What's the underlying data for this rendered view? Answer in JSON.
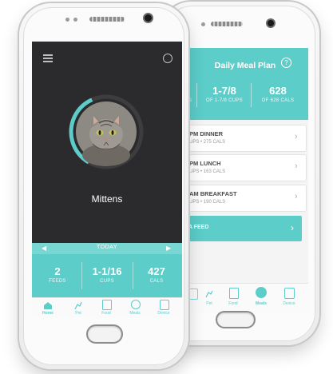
{
  "back_phone": {
    "header_title": "Daily Meal Plan",
    "help_icon": "question-circle-icon",
    "stats": [
      {
        "value": "",
        "label": "S"
      },
      {
        "value": "1-7/8",
        "label": "OF 1-7/8 CUPS"
      },
      {
        "value": "628",
        "label": "OF 628 CALS"
      }
    ],
    "meals": [
      {
        "title": "PM DINNER",
        "sub": "UPS • 275 CALS"
      },
      {
        "title": "PM LUNCH",
        "sub": "UPS • 163 CALS"
      },
      {
        "title": "AM BREAKFAST",
        "sub": "UPS • 190 CALS"
      }
    ],
    "add_feed_label": "A FEED",
    "nav": [
      {
        "label": "",
        "icon": "home-icon"
      },
      {
        "label": "Pet",
        "icon": "pet-icon"
      },
      {
        "label": "Food",
        "icon": "food-bag-icon"
      },
      {
        "label": "Meals",
        "icon": "meals-icon"
      },
      {
        "label": "Device",
        "icon": "device-icon"
      }
    ]
  },
  "front_phone": {
    "menu_icon": "hamburger-menu-icon",
    "settings_icon": "circle-settings-icon",
    "pet_name": "Mittens",
    "progress_fraction": 0.35,
    "date_label": "TODAY",
    "stats": [
      {
        "value": "2",
        "label": "FEEDS"
      },
      {
        "value": "1-1/16",
        "label": "CUPS"
      },
      {
        "value": "427",
        "label": "CALS"
      }
    ],
    "nav": [
      {
        "label": "Home",
        "icon": "home-icon",
        "active": true
      },
      {
        "label": "Pet",
        "icon": "pet-icon"
      },
      {
        "label": "Food",
        "icon": "food-bag-icon"
      },
      {
        "label": "Meals",
        "icon": "meals-icon"
      },
      {
        "label": "Device",
        "icon": "device-icon"
      }
    ]
  },
  "colors": {
    "accent": "#5ccdc9",
    "dark_bg": "#2b2b2d",
    "avatar_ring": "#5ccdc9"
  }
}
